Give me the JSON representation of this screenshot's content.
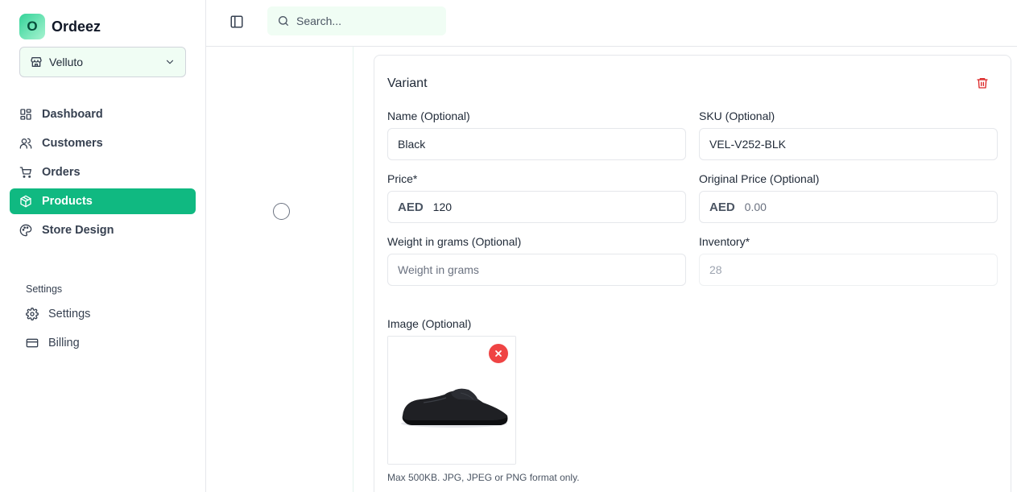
{
  "brand": {
    "logo_letter": "O",
    "name": "Ordeez"
  },
  "store_selector": {
    "value": "Velluto"
  },
  "nav": {
    "items": [
      {
        "label": "Dashboard",
        "icon": "dashboard-icon"
      },
      {
        "label": "Customers",
        "icon": "users-icon"
      },
      {
        "label": "Orders",
        "icon": "cart-icon"
      },
      {
        "label": "Products",
        "icon": "box-icon",
        "active": true
      },
      {
        "label": "Store Design",
        "icon": "palette-icon"
      }
    ],
    "settings_header": "Settings",
    "settings_items": [
      {
        "label": "Settings",
        "icon": "gear-icon"
      },
      {
        "label": "Billing",
        "icon": "credit-card-icon"
      }
    ]
  },
  "topbar": {
    "search_placeholder": "Search..."
  },
  "variant": {
    "title": "Variant",
    "name_label": "Name (Optional)",
    "name_value": "Black",
    "sku_label": "SKU (Optional)",
    "sku_value": "VEL-V252-BLK",
    "price_label": "Price*",
    "price_currency": "AED",
    "price_value": "120",
    "original_price_label": "Original Price (Optional)",
    "original_price_currency": "AED",
    "original_price_placeholder": "0.00",
    "weight_label": "Weight in grams (Optional)",
    "weight_placeholder": "Weight in grams",
    "inventory_label": "Inventory*",
    "inventory_value": "28",
    "image_label": "Image (Optional)",
    "image_hint": "Max 500KB. JPG, JPEG or PNG format only."
  },
  "colors": {
    "accent": "#10b981",
    "danger": "#ef4444"
  }
}
